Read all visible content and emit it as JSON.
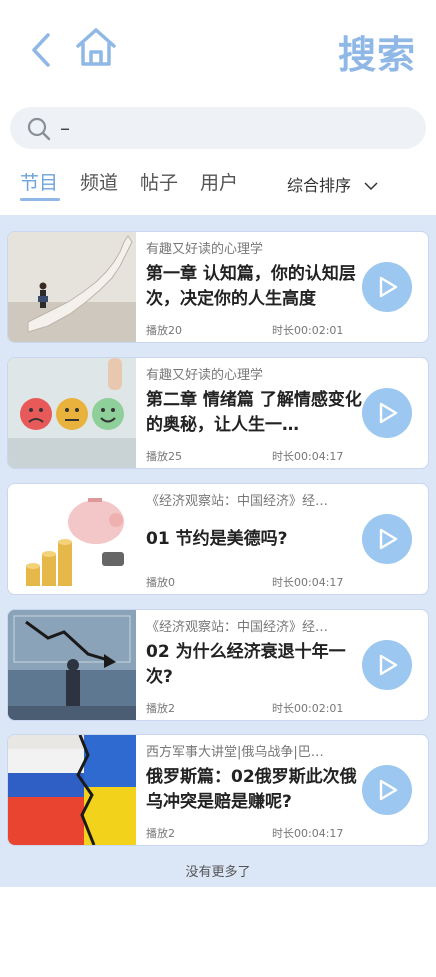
{
  "header": {
    "title": "搜索",
    "back_icon": "chevron-left-icon",
    "home_icon": "home-icon"
  },
  "search": {
    "value": "–",
    "icon": "search-icon"
  },
  "tabs": [
    {
      "label": "节目",
      "active": true
    },
    {
      "label": "频道",
      "active": false
    },
    {
      "label": "帖子",
      "active": false
    },
    {
      "label": "用户",
      "active": false
    }
  ],
  "sort": {
    "label": "综合排序",
    "icon": "chevron-down-icon"
  },
  "colors": {
    "accent": "#8fb8e6",
    "list_bg": "#dbe6f7",
    "play": "#9cc7f0"
  },
  "items": [
    {
      "subtitle": "有趣又好读的心理学",
      "title": "第一章 认知篇，你的认知层次，决定你的人生高度",
      "plays": "播放20",
      "duration": "时长00:02:01"
    },
    {
      "subtitle": "有趣又好读的心理学",
      "title": "第二章 情绪篇 了解情感变化的奥秘，让人生一…",
      "plays": "播放25",
      "duration": "时长00:04:17"
    },
    {
      "subtitle": "《经济观察站：中国经济》经…",
      "title": "01 节约是美德吗?",
      "plays": "播放0",
      "duration": "时长00:04:17"
    },
    {
      "subtitle": "《经济观察站：中国经济》经…",
      "title": "02 为什么经济衰退十年一次?",
      "plays": "播放2",
      "duration": "时长00:02:01"
    },
    {
      "subtitle": "西方军事大讲堂|俄乌战争|巴…",
      "title": "俄罗斯篇：02俄罗斯此次俄乌冲突是赔是赚呢?",
      "plays": "播放2",
      "duration": "时长00:04:17"
    }
  ],
  "footer": {
    "no_more": "没有更多了"
  }
}
